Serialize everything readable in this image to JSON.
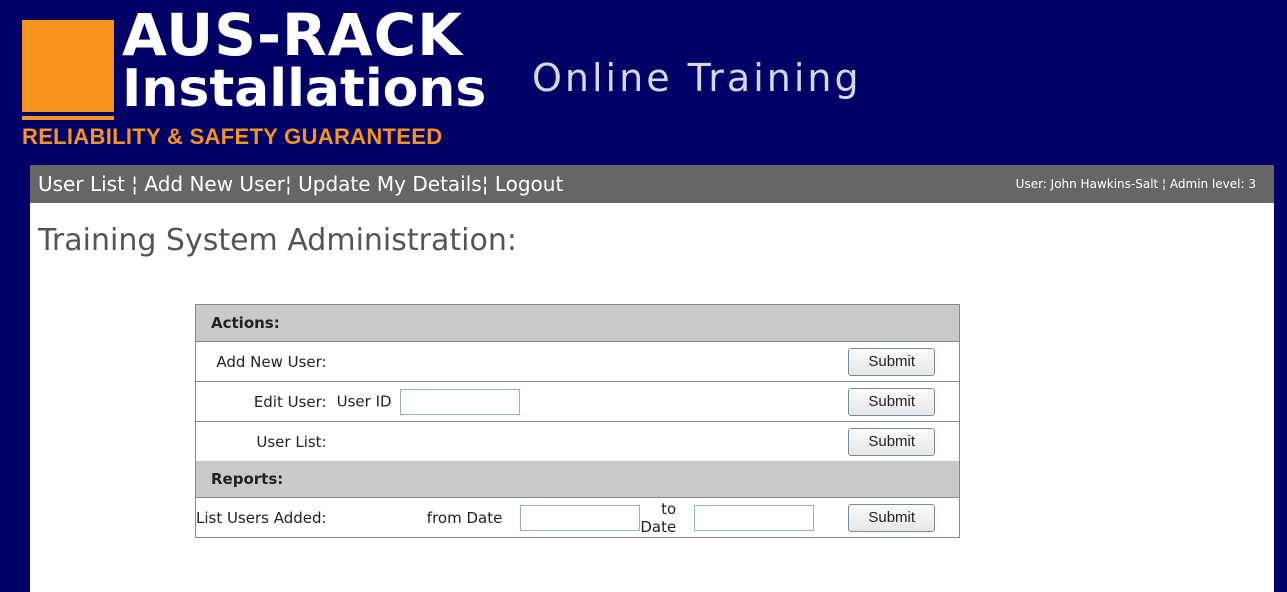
{
  "header": {
    "logo": {
      "line1": "AUS-RACK",
      "line2": "Installations",
      "tagline": "RELIABILITY & SAFETY GUARANTEED"
    },
    "site_title": "Online Training"
  },
  "nav": {
    "links": [
      {
        "label": "User List"
      },
      {
        "label": "Add New User"
      },
      {
        "label": "Update My Details"
      },
      {
        "label": "Logout"
      }
    ],
    "separator": "¦",
    "user_info": "User: John Hawkins-Salt ¦ Admin level: 3"
  },
  "main": {
    "title": "Training System Administration:",
    "sections": {
      "actions": {
        "heading": "Actions:",
        "add_user_label": "Add New User:",
        "edit_user_label": "Edit User:",
        "user_id_label": "User ID",
        "user_id_value": "",
        "user_list_label": "User List:"
      },
      "reports": {
        "heading": "Reports:",
        "list_users_label": "List Users Added:",
        "from_label": "from Date",
        "from_value": "",
        "to_label": "to Date",
        "to_value": ""
      }
    },
    "submit_label": "Submit"
  },
  "colors": {
    "background": "#000066",
    "accent_orange": "#f7941d",
    "navbar": "#666666",
    "section_header": "#c9c9c9"
  }
}
